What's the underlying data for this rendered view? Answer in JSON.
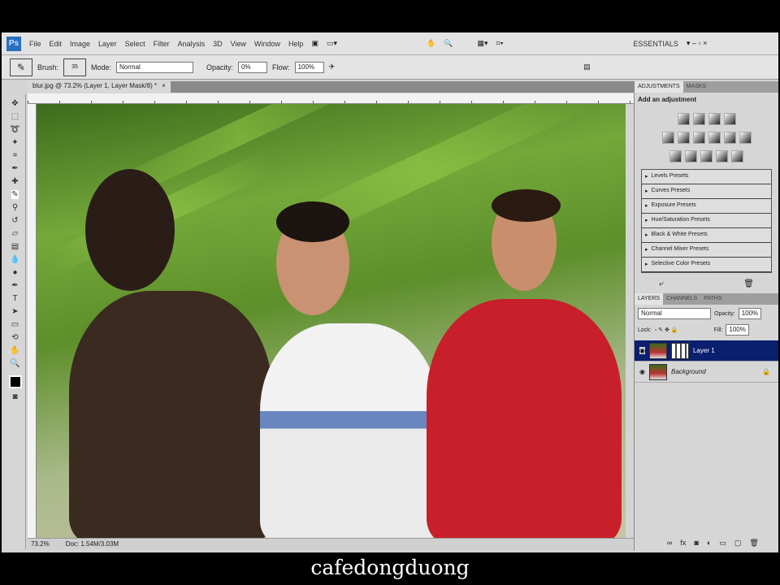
{
  "app_bar": {
    "logo": "Ps",
    "menus": [
      "File",
      "Edit",
      "Image",
      "Layer",
      "Select",
      "Filter",
      "Analysis",
      "3D",
      "View",
      "Window",
      "Help"
    ],
    "workspace": "ESSENTIALS"
  },
  "options_bar": {
    "brush_label": "Brush:",
    "brush_size": "35",
    "mode_label": "Mode:",
    "mode_value": "Normal",
    "opacity_label": "Opacity:",
    "opacity_value": "0%",
    "flow_label": "Flow:",
    "flow_value": "100%"
  },
  "document": {
    "tab_title": "blur.jpg @ 73.2% (Layer 1, Layer Mask/8) *",
    "close": "×",
    "zoom": "73.2%",
    "doc_size": "Doc: 1.54M/3.03M"
  },
  "adjustments": {
    "tabs": [
      "ADJUSTMENTS",
      "MASKS"
    ],
    "heading": "Add an adjustment",
    "presets": [
      "Levels Presets",
      "Curves Presets",
      "Exposure Presets",
      "Hue/Saturation Presets",
      "Black & White Presets",
      "Channel Mixer Presets",
      "Selective Color Presets"
    ]
  },
  "layers": {
    "tabs": [
      "LAYERS",
      "CHANNELS",
      "PATHS"
    ],
    "blend_mode": "Normal",
    "opacity_label": "Opacity:",
    "opacity_value": "100%",
    "lock_label": "Lock:",
    "fill_label": "Fill:",
    "fill_value": "100%",
    "items": [
      {
        "name": "Layer 1",
        "selected": true
      },
      {
        "name": "Background",
        "locked": true
      }
    ]
  },
  "caption": "cafedongduong",
  "colors": {
    "selected_layer": "#0a1f6e",
    "shirt_red": "#c8202a"
  }
}
